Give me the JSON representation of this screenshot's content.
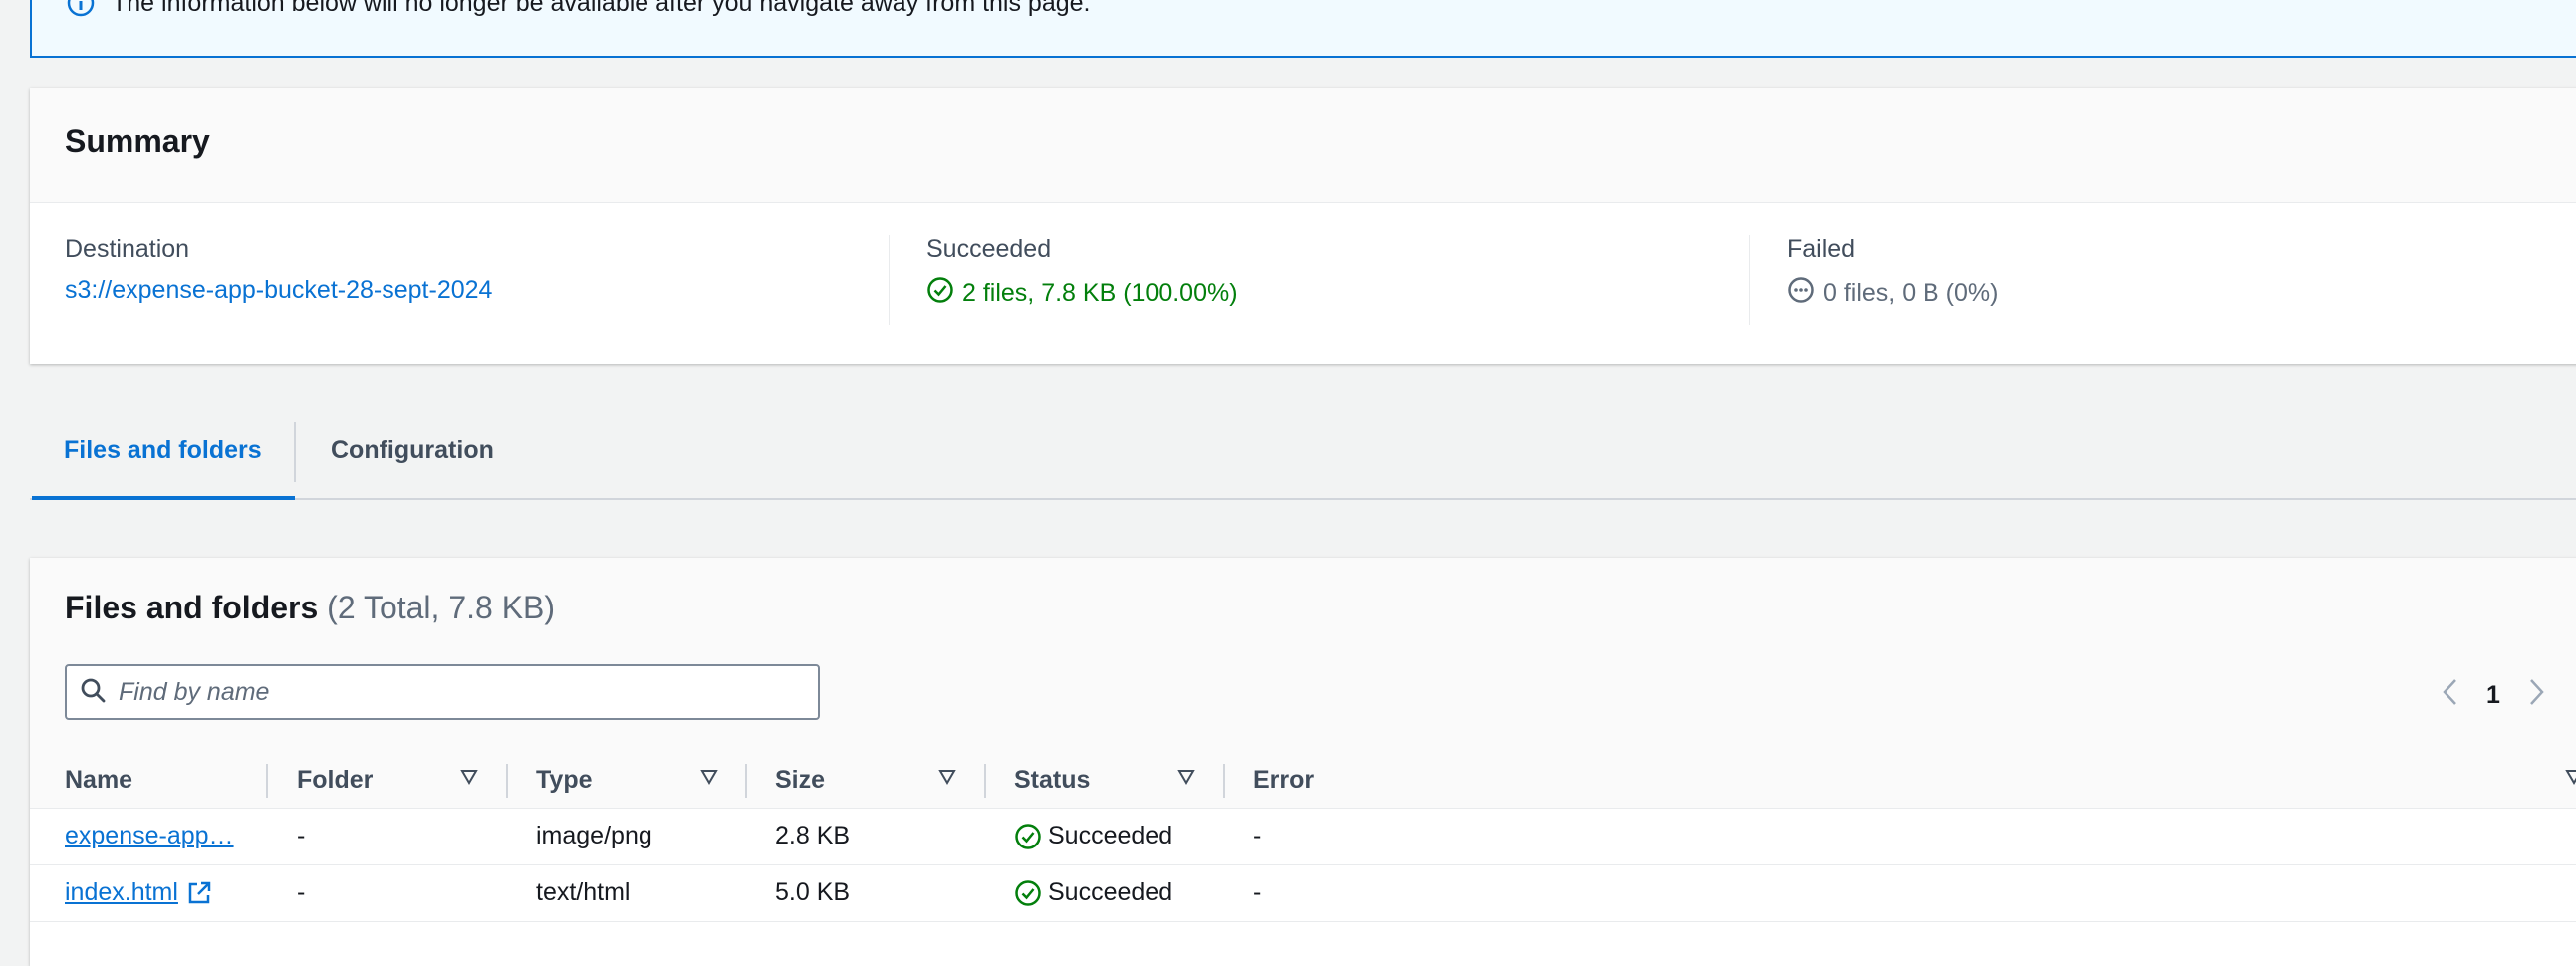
{
  "banner": {
    "text": "The information below will no longer be available after you navigate away from this page."
  },
  "summary": {
    "title": "Summary",
    "destination": {
      "label": "Destination",
      "value": "s3://expense-app-bucket-28-sept-2024"
    },
    "succeeded": {
      "label": "Succeeded",
      "value": "2 files, 7.8 KB (100.00%)"
    },
    "failed": {
      "label": "Failed",
      "value": "0 files, 0 B (0%)"
    }
  },
  "tabs": {
    "active": "Files and folders",
    "inactive": "Configuration"
  },
  "files": {
    "title": "Files and folders",
    "count": "(2 Total, 7.8 KB)",
    "search_placeholder": "Find by name",
    "page": "1",
    "columns": [
      "Name",
      "Folder",
      "Type",
      "Size",
      "Status",
      "Error"
    ],
    "rows": [
      {
        "name": "expense-app…",
        "folder": "-",
        "type": "image/png",
        "size": "2.8 KB",
        "status": "Succeeded",
        "error": "-"
      },
      {
        "name": "index.html",
        "folder": "-",
        "type": "text/html",
        "size": "5.0 KB",
        "status": "Succeeded",
        "error": "-"
      }
    ]
  },
  "colors": {
    "link": "#0972d3",
    "success": "#037f0c",
    "info_bg": "#f1faff"
  }
}
